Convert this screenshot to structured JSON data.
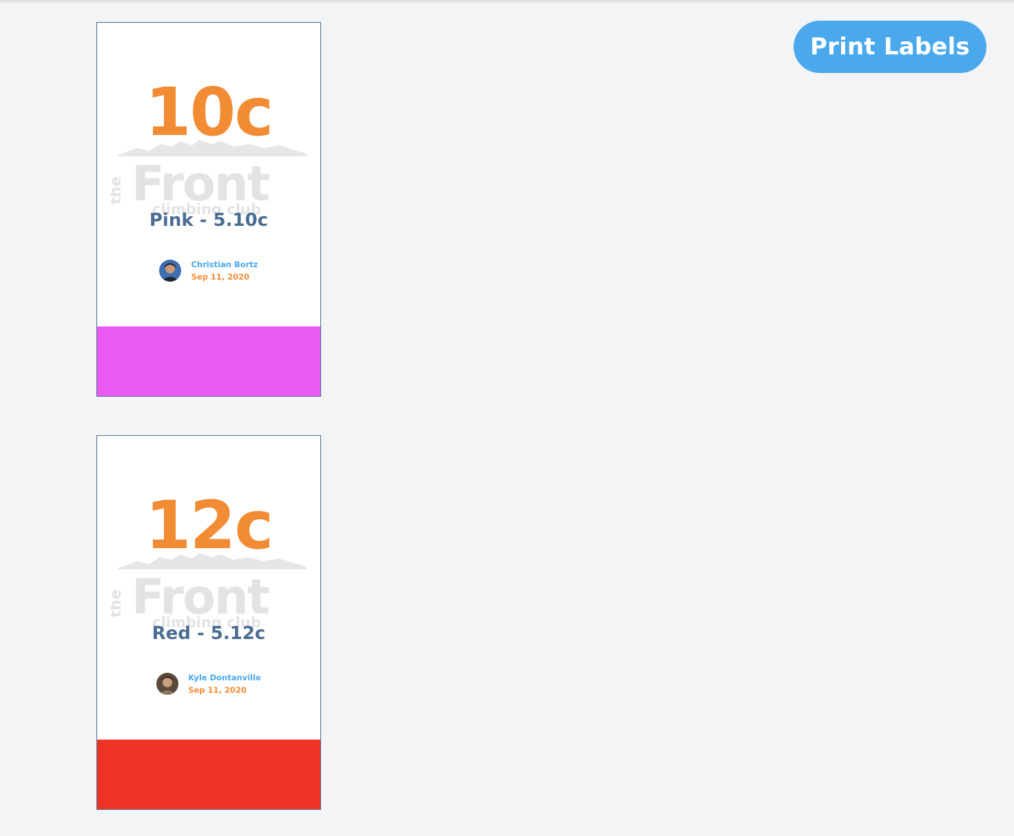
{
  "toolbar": {
    "print_label": "Print Labels"
  },
  "labels": [
    {
      "grade": "10c",
      "route": "Pink - 5.10c",
      "setter_name": "Christian Bortz",
      "date": "Sep 11, 2020",
      "color": "#eb59f5",
      "logo_text": {
        "the": "the",
        "main": "Front",
        "sub": "climbing club"
      }
    },
    {
      "grade": "12c",
      "route": "Red - 5.12c",
      "setter_name": "Kyle Dontanville",
      "date": "Sep 11, 2020",
      "color": "#ed3426",
      "logo_text": {
        "the": "the",
        "main": "Front",
        "sub": "climbing club"
      }
    }
  ],
  "colors": {
    "accent": "#4aa8ec",
    "grade": "#f28c34",
    "route_text": "#4c6d92",
    "background": "#f2f4f6"
  }
}
